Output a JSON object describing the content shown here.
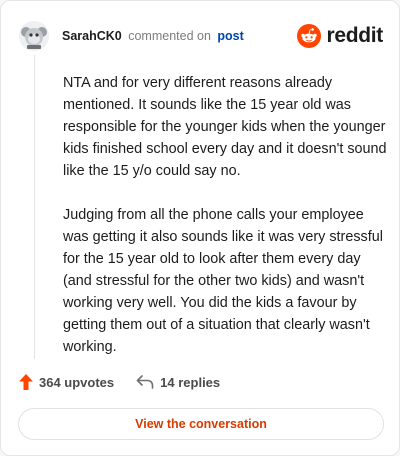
{
  "header": {
    "username": "SarahCK0",
    "action_text": "commented on",
    "target_link": "post",
    "brand_name": "reddit"
  },
  "comment": {
    "paragraphs": [
      "NTA and for very different reasons already mentioned. It sounds like the 15 year old was responsible for the younger kids when the younger kids finished school every day and it doesn't sound like the 15 y/o could say no.",
      "Judging from all the phone calls your employee was getting it also sounds like it was very stressful for the 15 year old to look after them every day (and stressful for the other two kids) and wasn't working very well. You did the kids a favour by getting them out of a situation that clearly wasn't working."
    ]
  },
  "stats": {
    "upvotes": "364 upvotes",
    "replies": "14 replies"
  },
  "actions": {
    "view_conversation": "View the conversation"
  },
  "colors": {
    "brand": "#ff4500",
    "link": "#0045ac",
    "button_text": "#d93a00"
  },
  "icons": [
    "avatar-icon",
    "reddit-logo-icon",
    "upvote-arrow-icon",
    "reply-arrow-icon"
  ]
}
